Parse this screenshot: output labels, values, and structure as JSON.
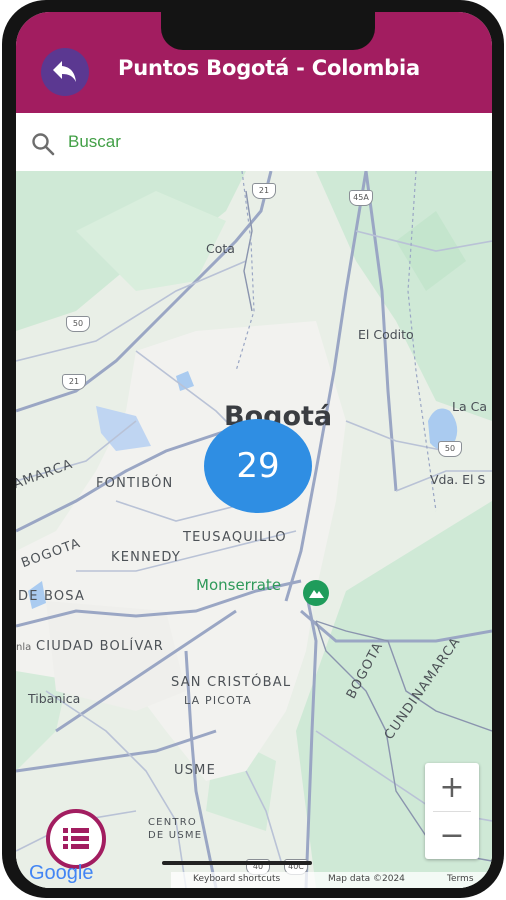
{
  "header": {
    "title": "Puntos Bogotá - Colombia",
    "back_icon": "back-arrow-icon",
    "background": "#a21d60"
  },
  "search": {
    "placeholder": "Buscar",
    "icon": "search-icon"
  },
  "map": {
    "city_label": "Bogotá",
    "place_labels": {
      "cota": "Cota",
      "el_codito": "El Codito",
      "la_ca": "La Ca",
      "vda_el_s": "Vda. El S",
      "fontibon": "FONTIBÓN",
      "teusaquillo": "TEUSAQUILLO",
      "kennedy": "KENNEDY",
      "bogota_west": "BOGOTA",
      "de_bosa": "DE BOSA",
      "ciudad_bolivar": "CIUDAD BOLÍVAR",
      "san_cristobal": "SAN CRISTÓBAL",
      "la_picota": "LA PICOTA",
      "tibanica": "Tibanica",
      "usme": "USME",
      "centro_de_usme_1": "CENTRO",
      "centro_de_usme_2": "DE USME",
      "monserrate": "Monserrate",
      "amarca": "AMARCA",
      "bogota_east": "BOGOTA",
      "cundinamarca_1": "CUNDINAMARCA",
      "cundinamarca_2": "CUNDINAMARCA",
      "nla": "nla"
    },
    "route_shields": {
      "r21_top": "21",
      "r45a": "45A",
      "r50_left": "50",
      "r21_left": "21",
      "r50_right": "50",
      "r40": "40",
      "r40c": "40C"
    },
    "cluster": {
      "count": "29",
      "color": "#2f8ee3"
    },
    "park_icon": "mountain-icon",
    "zoom_in": "+",
    "zoom_out": "−",
    "menu_icon": "list-menu-icon",
    "google_logo": "Google",
    "attribution": {
      "shortcuts": "Keyboard shortcuts",
      "data": "Map data ©2024",
      "terms": "Terms"
    }
  }
}
